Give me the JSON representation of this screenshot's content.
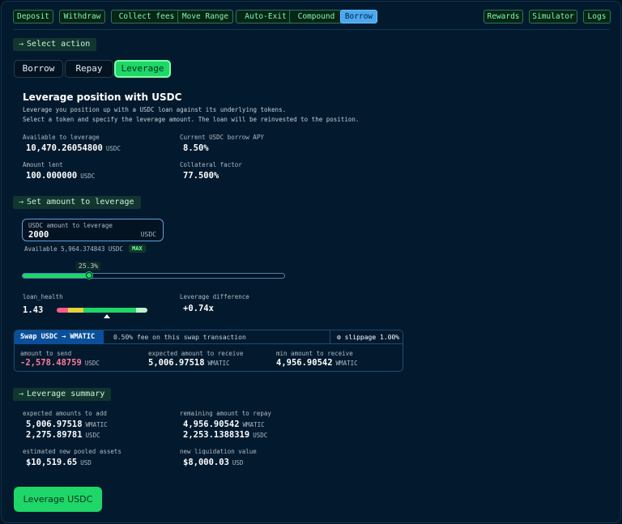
{
  "nav": {
    "left": [
      "Deposit",
      "Withdraw",
      "Collect fees",
      "Move Range",
      "Auto-Exit",
      "Compound",
      "Borrow"
    ],
    "right": [
      "Rewards",
      "Simulator",
      "Logs"
    ],
    "active": "Borrow"
  },
  "select_action": {
    "label": "Select action"
  },
  "tabs": [
    "Borrow",
    "Repay",
    "Leverage"
  ],
  "heading": "Leverage position with USDC",
  "desc_line1": "Leverage you position up with a USDC loan against its underlying tokens.",
  "desc_line2": "Select a token and specify the leverage amount. The loan will be reinvested to the position.",
  "stats": {
    "available_label": "Available to leverage",
    "available_value": "10,470.26054800",
    "available_unit": "USDC",
    "apy_label": "Current USDC borrow APY",
    "apy_value": "8.50%",
    "lent_label": "Amount lent",
    "lent_value": "100.000000",
    "lent_unit": "USDC",
    "collateral_label": "Collateral factor",
    "collateral_value": "77.500%"
  },
  "set_amount": {
    "label": "Set amount to leverage"
  },
  "input": {
    "label": "USDC amount to leverage",
    "value": "2000",
    "unit": "USDC",
    "available": "Available 5,964.374843 USDC",
    "max": "MAX"
  },
  "slider": {
    "percent_label": "25.3%",
    "fraction": 0.253
  },
  "health": {
    "label": "loan_health",
    "value": "1.43",
    "diff_label": "Leverage difference",
    "diff_value": "+0.74x"
  },
  "swap": {
    "title": "Swap USDC → WMATIC",
    "fee": "0.50% fee on this swap transaction",
    "slippage": "slippage 1.00%",
    "send_label": "amount to send",
    "send_value": "-2,578.48759",
    "send_unit": "USDC",
    "expected_label": "expected amount to receive",
    "expected_value": "5,006.97518",
    "expected_unit": "WMATIC",
    "min_label": "min amount to receive",
    "min_value": "4,956.90542",
    "min_unit": "WMATIC"
  },
  "summary": {
    "label": "Leverage summary",
    "add_label": "expected amounts to add",
    "add_1_value": "5,006.97518",
    "add_1_unit": "WMATIC",
    "add_2_value": "2,275.89781",
    "add_2_unit": "USDC",
    "repay_label": "remaining amount to repay",
    "repay_1_value": "4,956.90542",
    "repay_1_unit": "WMATIC",
    "repay_2_value": "2,253.1388319",
    "repay_2_unit": "USDC",
    "pooled_label": "estimated new pooled assets",
    "pooled_value": "$10,519.65",
    "pooled_unit": "USD",
    "liq_label": "new liquidation value",
    "liq_value": "$8,000.03",
    "liq_unit": "USD"
  },
  "action_button": "Leverage USDC",
  "colors": {
    "accent_green": "#1ed768",
    "active_blue": "#4aa8f0",
    "background": "#031a2e",
    "negative": "#ff7a9c"
  }
}
